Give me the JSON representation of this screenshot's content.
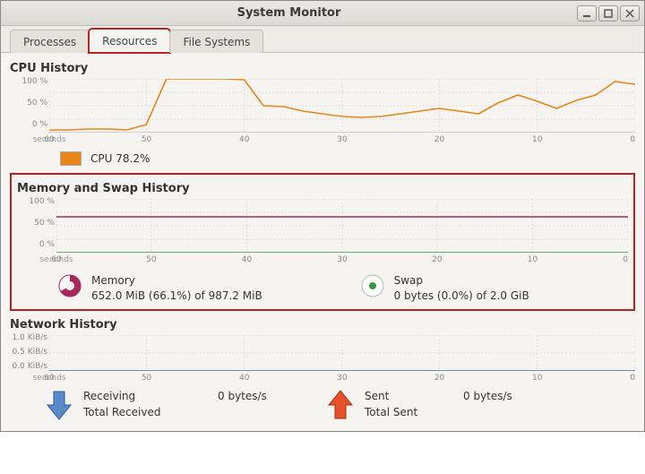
{
  "window": {
    "title": "System Monitor"
  },
  "tabs": {
    "processes": "Processes",
    "resources": "Resources",
    "filesystems": "File Systems"
  },
  "cpu": {
    "title": "CPU History",
    "y100": "100 %",
    "y50": "50 %",
    "y0": "0 %",
    "legend_label": "CPU",
    "legend_value": "78.2%",
    "color": "#e8861c"
  },
  "xaxis": {
    "t60": "60",
    "seconds": "seconds",
    "t50": "50",
    "t40": "40",
    "t30": "30",
    "t20": "20",
    "t10": "10",
    "t0": "0"
  },
  "mem": {
    "title": "Memory and Swap History",
    "y100": "100 %",
    "y50": "50 %",
    "y0": "0 %",
    "memory_label": "Memory",
    "memory_value": "652.0 MiB (66.1%) of 987.2 MiB",
    "swap_label": "Swap",
    "swap_value": "0 bytes (0.0%) of 2.0 GiB",
    "memory_color": "#a8285a",
    "swap_color": "#3a9a3a"
  },
  "net": {
    "title": "Network History",
    "y10": "1.0 KiB/s",
    "y05": "0.5 KiB/s",
    "y00": "0.0 KiB/s",
    "receiving_label": "Receiving",
    "receiving_value": "0 bytes/s",
    "total_received_label": "Total Received",
    "sent_label": "Sent",
    "sent_value": "0 bytes/s",
    "total_sent_label": "Total Sent",
    "recv_color": "#3a6aa8",
    "sent_color": "#d23a1c"
  },
  "chart_data": [
    {
      "type": "line",
      "title": "CPU History",
      "xlabel": "seconds",
      "ylabel": "%",
      "xlim": [
        60,
        0
      ],
      "ylim": [
        0,
        100
      ],
      "x": [
        60,
        58,
        56,
        54,
        52,
        50,
        48,
        46,
        44,
        42,
        40,
        38,
        36,
        34,
        32,
        30,
        28,
        26,
        24,
        22,
        20,
        18,
        16,
        14,
        12,
        10,
        8,
        6,
        4,
        2,
        0
      ],
      "series": [
        {
          "name": "CPU",
          "color": "#e8861c",
          "values": [
            5,
            5,
            6,
            6,
            5,
            15,
            100,
            100,
            100,
            100,
            98,
            50,
            48,
            40,
            35,
            30,
            28,
            30,
            35,
            40,
            45,
            40,
            35,
            55,
            70,
            58,
            45,
            60,
            70,
            95,
            90
          ]
        }
      ]
    },
    {
      "type": "line",
      "title": "Memory and Swap History",
      "xlabel": "seconds",
      "ylabel": "%",
      "xlim": [
        60,
        0
      ],
      "ylim": [
        0,
        100
      ],
      "x": [
        60,
        50,
        40,
        30,
        20,
        10,
        0
      ],
      "series": [
        {
          "name": "Memory",
          "color": "#a8285a",
          "values": [
            66,
            66,
            66,
            66,
            66,
            66,
            66
          ]
        },
        {
          "name": "Swap",
          "color": "#3a9a3a",
          "values": [
            0,
            0,
            0,
            0,
            0,
            0,
            0
          ]
        }
      ]
    },
    {
      "type": "line",
      "title": "Network History",
      "xlabel": "seconds",
      "ylabel": "KiB/s",
      "xlim": [
        60,
        0
      ],
      "ylim": [
        0,
        1.0
      ],
      "x": [
        60,
        50,
        40,
        30,
        20,
        10,
        0
      ],
      "series": [
        {
          "name": "Receiving",
          "color": "#3a6aa8",
          "values": [
            0,
            0,
            0,
            0,
            0,
            0,
            0
          ]
        },
        {
          "name": "Sent",
          "color": "#d23a1c",
          "values": [
            0,
            0,
            0,
            0,
            0,
            0,
            0
          ]
        }
      ]
    }
  ]
}
